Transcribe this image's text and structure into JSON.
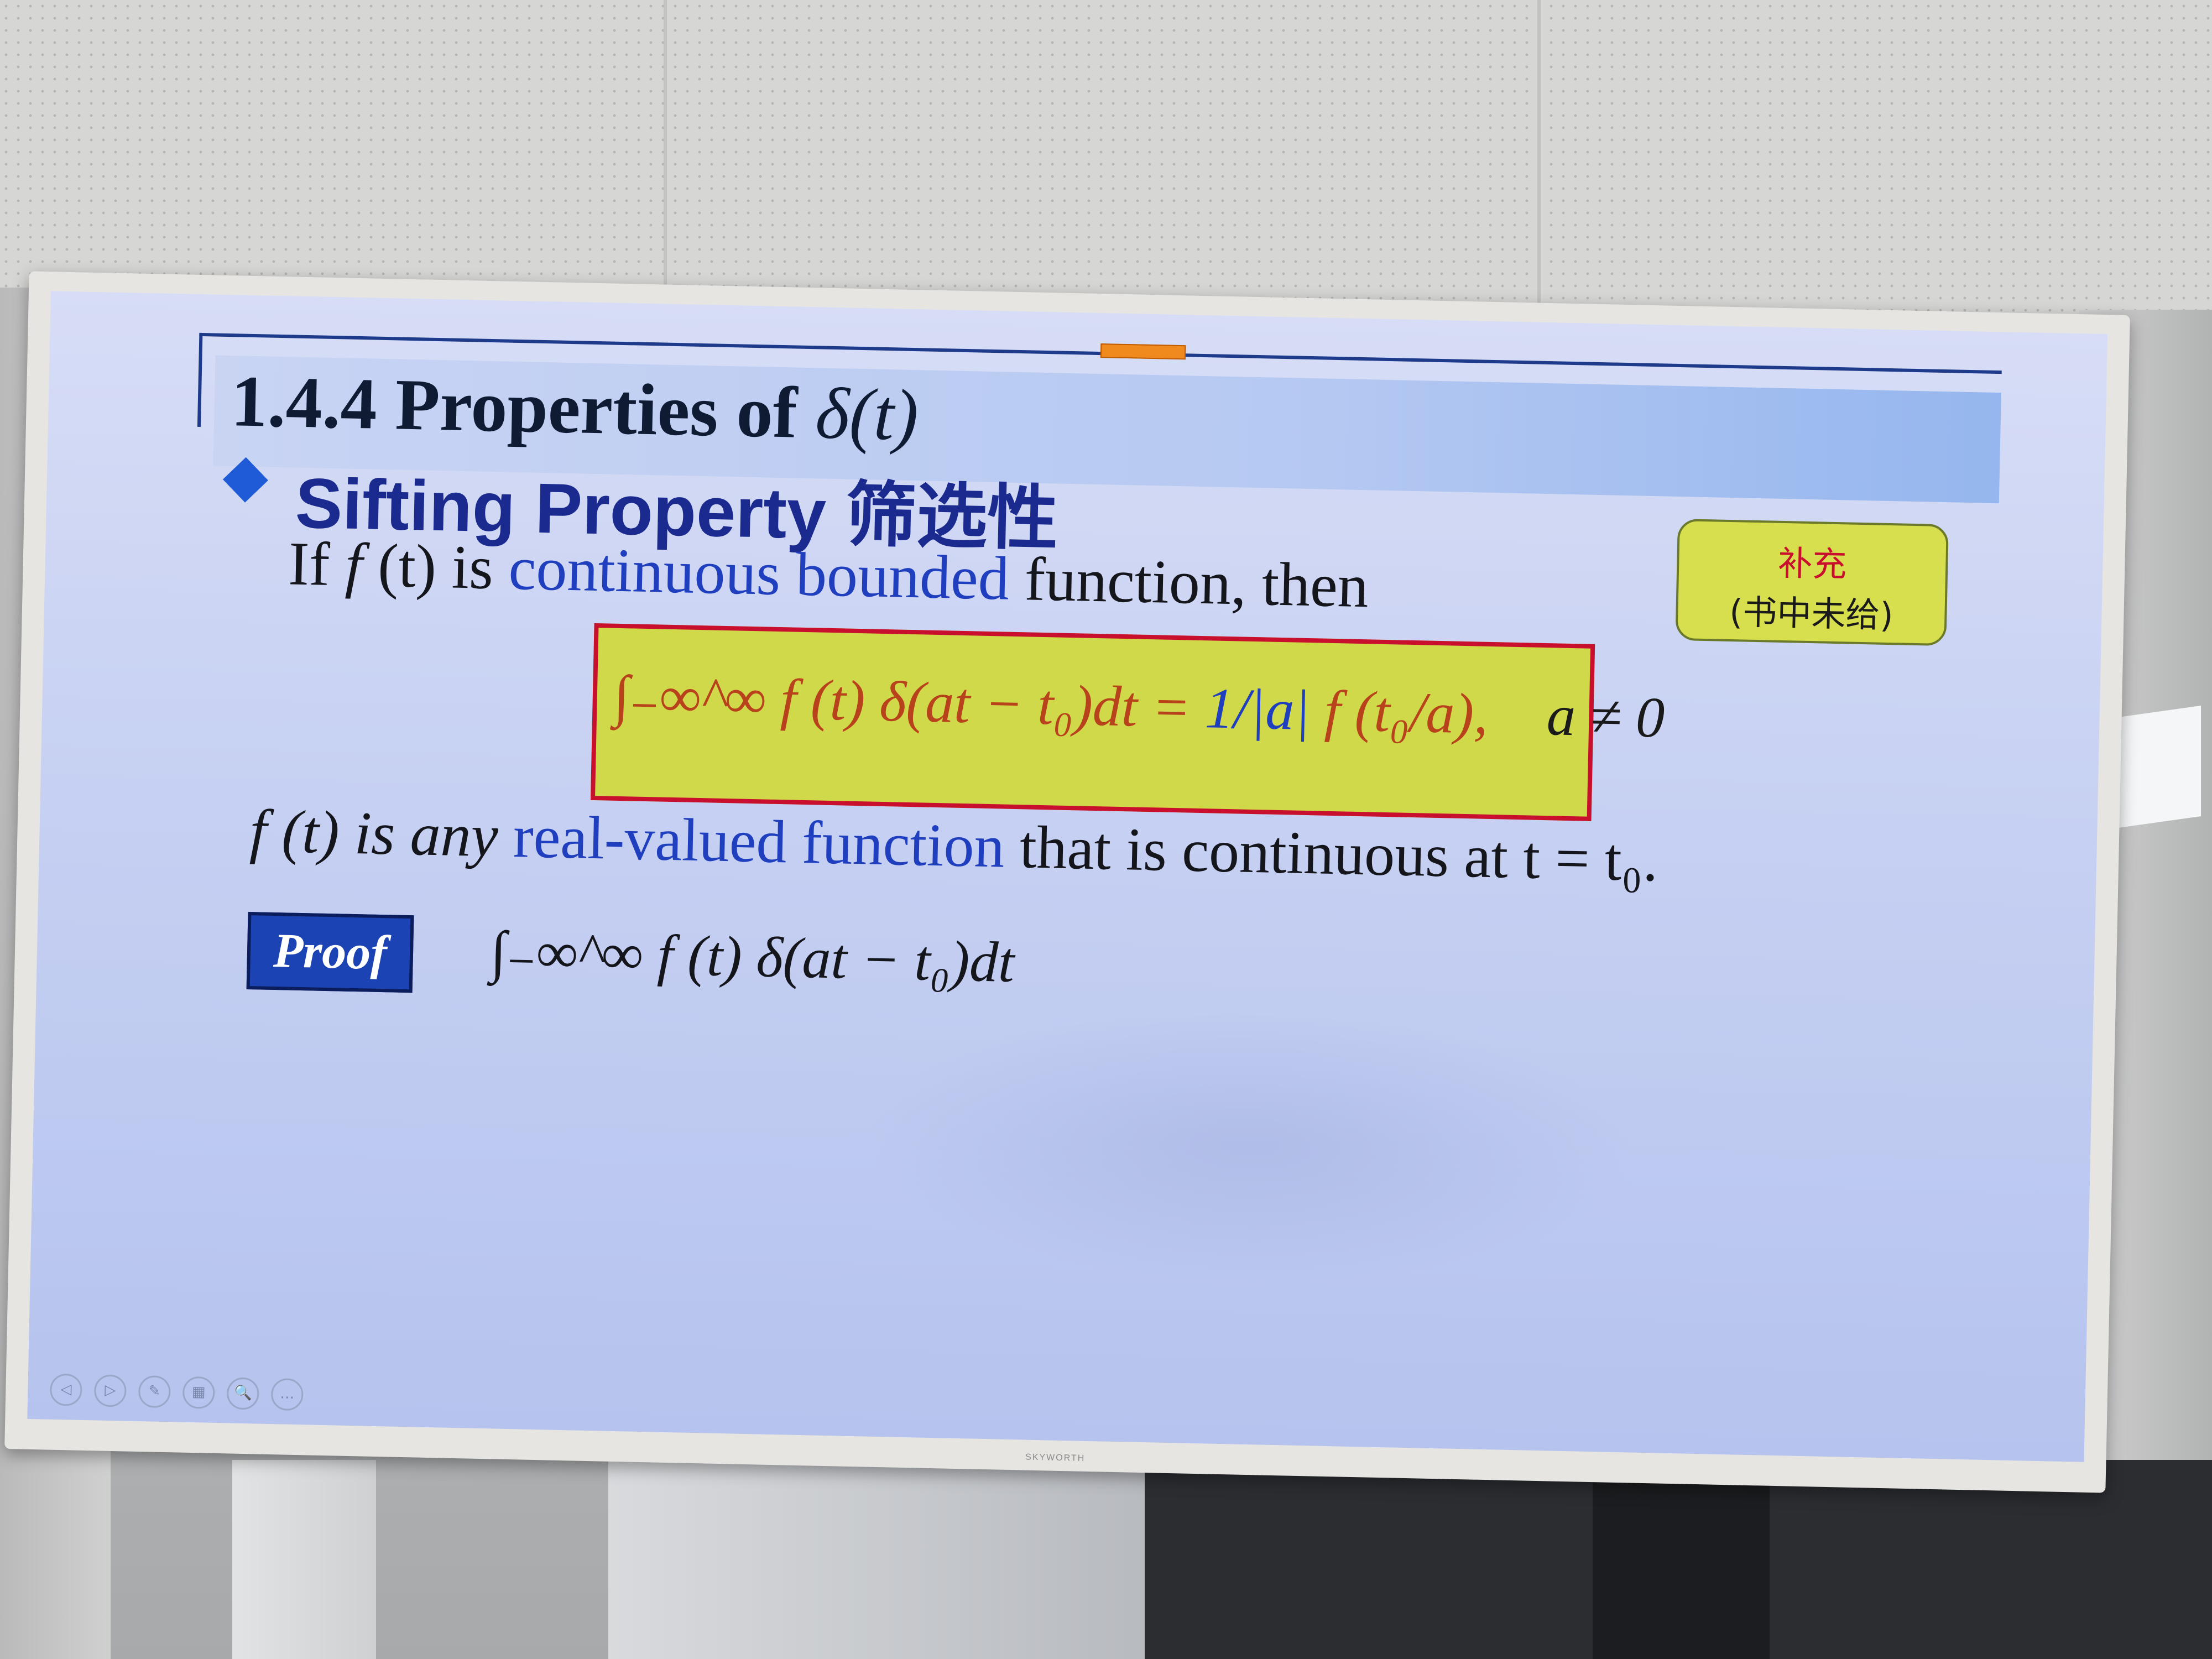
{
  "slide": {
    "title_prefix": "1.4.4  Properties of ",
    "title_symbol": "δ",
    "title_arg": "(t)",
    "subtitle": "Sifting Property 筛选性",
    "line1": {
      "part1": "If ",
      "f": "f",
      "part2": " (t) is ",
      "highlight": "continuous bounded",
      "part3": " function, then"
    },
    "formula": {
      "lhs": "∫₋∞^∞ f (t) δ(at − t₀)dt = ",
      "coef": "1/|a|",
      "rhs": " f (t₀/a),",
      "condition": "a ≠ 0"
    },
    "callout": {
      "line1": "补充",
      "line2": "(书中未给)"
    },
    "line2": {
      "part1": "f (t) is any ",
      "highlight": "real-valued function",
      "part2": " that is continuous at t = t₀."
    },
    "proof_label": "Proof",
    "proof_formula": "∫₋∞^∞ f (t) δ(at − t₀)dt"
  },
  "toolbar": {
    "buttons": [
      "◁",
      "▷",
      "✎",
      "▦",
      "🔍",
      "…"
    ]
  },
  "brand": "SKYWORTH",
  "colors": {
    "title_text": "#0f1a33",
    "subtitle_text": "#1a2a8f",
    "highlight_blue": "#1f3fbf",
    "formula_box_fill": "#cfd94a",
    "formula_box_border": "#c8102e",
    "proof_button": "#1b43b3"
  }
}
